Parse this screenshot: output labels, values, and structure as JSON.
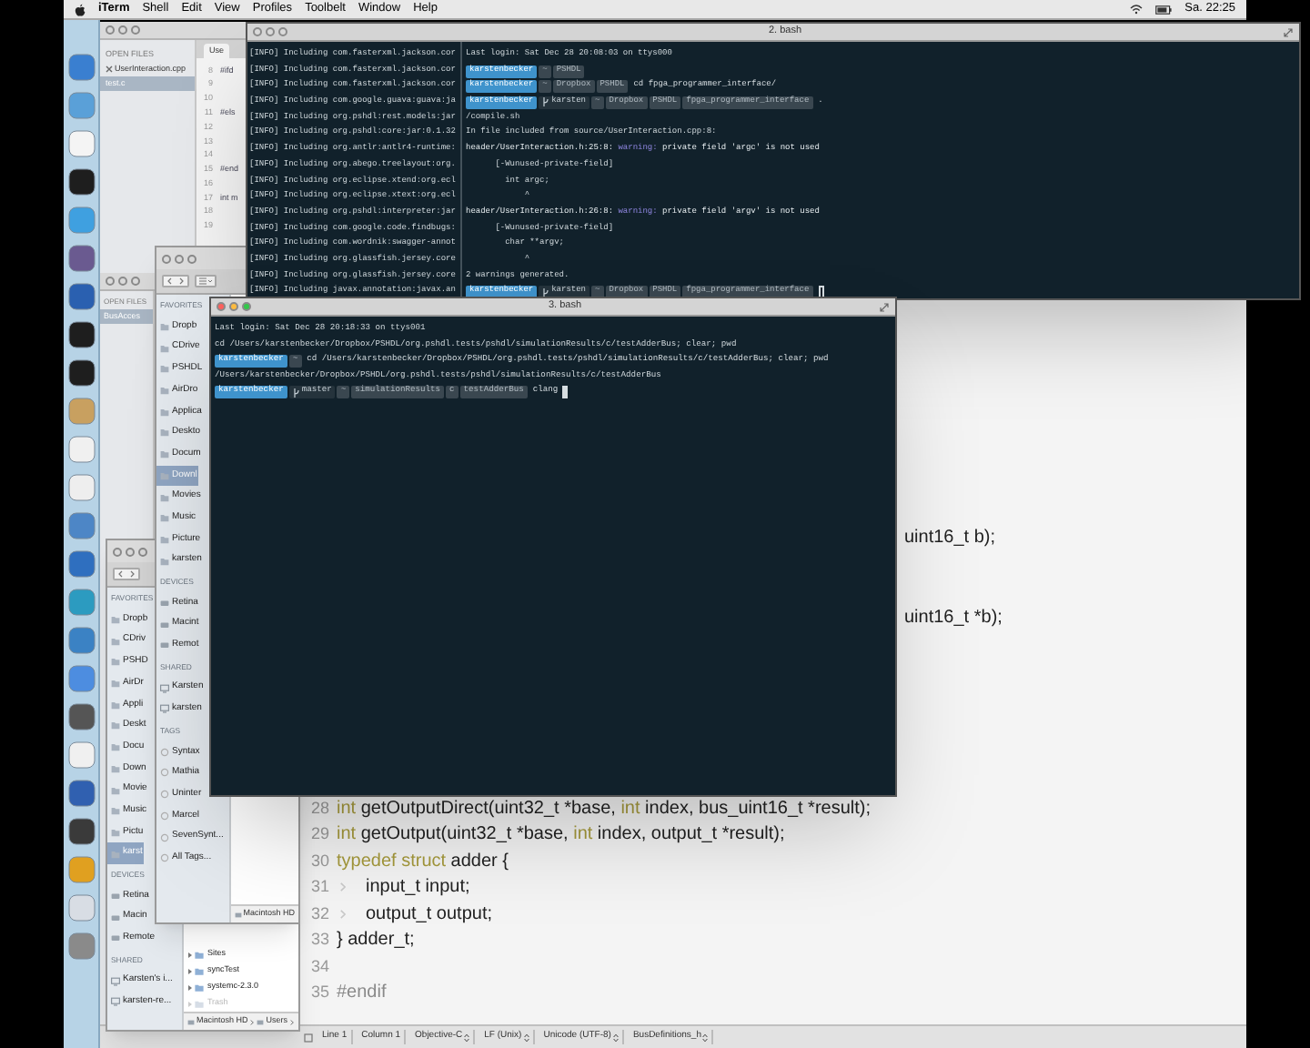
{
  "menu_bar": {
    "app": "iTerm",
    "items": [
      "Shell",
      "Edit",
      "View",
      "Profiles",
      "Toolbelt",
      "Window",
      "Help"
    ],
    "clock": "Sa. 22:25"
  },
  "editor_back": {
    "sidebar_heading": "OPEN FILES",
    "files": [
      {
        "name": "UserInteraction.cpp",
        "selected": false,
        "close_button": true
      },
      {
        "name": "test.c",
        "selected": true,
        "close_button": false
      }
    ],
    "tab": "Use",
    "lines": [
      {
        "number": "8",
        "text": "#ifd"
      },
      {
        "number": "9"
      },
      {
        "number": "10"
      },
      {
        "number": "11",
        "text": "#els"
      },
      {
        "number": "12"
      },
      {
        "number": "13"
      },
      {
        "number": "14"
      },
      {
        "number": "15",
        "text": "#end"
      },
      {
        "number": "16"
      },
      {
        "number": "17",
        "text": "int m"
      },
      {
        "number": "18"
      },
      {
        "number": "19"
      }
    ]
  },
  "editor": {
    "sidebar_heading": "OPEN FILES",
    "files": [
      {
        "name": "BusAcces",
        "selected": true
      }
    ],
    "fragments": [
      "uint16_t b);",
      "uint16_t *b);"
    ],
    "lines": [
      {
        "number": "28",
        "tokens": [
          {
            "kind": "keyword",
            "text": "int"
          },
          {
            "kind": "plain",
            "text": " getOutputDirect(uint32_t *base, "
          },
          {
            "kind": "keyword",
            "text": "int"
          },
          {
            "kind": "plain",
            "text": " index, bus_uint16_t *result);"
          }
        ]
      },
      {
        "number": "29",
        "tokens": [
          {
            "kind": "keyword",
            "text": "int"
          },
          {
            "kind": "plain",
            "text": " getOutput(uint32_t *base, "
          },
          {
            "kind": "keyword",
            "text": "int"
          },
          {
            "kind": "plain",
            "text": " index, output_t *result);"
          }
        ]
      },
      {
        "number": "30",
        "tokens": [
          {
            "kind": "keyword",
            "text": "typedef struct"
          },
          {
            "kind": "plain",
            "text": " adder {"
          }
        ]
      },
      {
        "number": "31",
        "tokens": [
          {
            "kind": "tab"
          },
          {
            "kind": "plain",
            "text": "input_t input;"
          }
        ]
      },
      {
        "number": "32",
        "tokens": [
          {
            "kind": "tab"
          },
          {
            "kind": "plain",
            "text": "output_t output;"
          }
        ]
      },
      {
        "number": "33",
        "tokens": [
          {
            "kind": "plain",
            "text": "} adder_t;"
          }
        ]
      },
      {
        "number": "34"
      },
      {
        "number": "35",
        "tokens": [
          {
            "kind": "directive",
            "text": "#endif"
          }
        ]
      }
    ],
    "status_bar": [
      {
        "label": "Line 1",
        "dropdown": false
      },
      {
        "label": "Column 1",
        "dropdown": false
      },
      {
        "label": "Objective-C",
        "dropdown": true
      },
      {
        "label": "LF (Unix)",
        "dropdown": true
      },
      {
        "label": "Unicode (UTF-8)",
        "dropdown": true
      },
      {
        "label": "BusDefinitions_h",
        "dropdown": true
      }
    ]
  },
  "finders": [
    {
      "sections": [
        {
          "kind": "favorites",
          "heading": "FAVORITES",
          "items": [
            {
              "label": "Dropb",
              "selected": false
            },
            {
              "label": "CDrive",
              "selected": false
            },
            {
              "label": "PSHDL",
              "selected": false
            },
            {
              "label": "AirDro",
              "selected": false
            },
            {
              "label": "Applica",
              "selected": false
            },
            {
              "label": "Deskto",
              "selected": false
            },
            {
              "label": "Docum",
              "selected": false
            },
            {
              "label": "Downl",
              "selected": true
            },
            {
              "label": "Movies",
              "selected": false
            },
            {
              "label": "Music",
              "selected": false
            },
            {
              "label": "Picture",
              "selected": false
            },
            {
              "label": "karsten",
              "selected": false
            }
          ]
        },
        {
          "kind": "devices",
          "heading": "DEVICES",
          "items": [
            {
              "label": "Retina",
              "selected": false
            },
            {
              "label": "Macint",
              "selected": false
            },
            {
              "label": "Remot",
              "selected": false
            }
          ]
        },
        {
          "kind": "shared",
          "heading": "SHARED",
          "items": [
            {
              "label": "Karsten",
              "selected": false
            },
            {
              "label": "karsten",
              "selected": false
            }
          ]
        },
        {
          "kind": "tags",
          "heading": "TAGS",
          "items": [
            {
              "label": "Syntax",
              "selected": false
            },
            {
              "label": "Mathia",
              "selected": false
            },
            {
              "label": "Uninter",
              "selected": false
            },
            {
              "label": "Marcel",
              "selected": false
            },
            {
              "label": "SevenSynt...",
              "selected": false
            },
            {
              "label": "All Tags...",
              "selected": false
            }
          ]
        }
      ],
      "path": [
        "Macintosh HD"
      ]
    },
    {
      "sections": [
        {
          "kind": "favorites",
          "heading": "FAVORITES",
          "items": [
            {
              "label": "Dropb",
              "selected": false
            },
            {
              "label": "CDriv",
              "selected": false
            },
            {
              "label": "PSHD",
              "selected": false
            },
            {
              "label": "AirDr",
              "selected": false
            },
            {
              "label": "Appli",
              "selected": false
            },
            {
              "label": "Deskt",
              "selected": false
            },
            {
              "label": "Docu",
              "selected": false
            },
            {
              "label": "Down",
              "selected": false
            },
            {
              "label": "Movie",
              "selected": false
            },
            {
              "label": "Music",
              "selected": false
            },
            {
              "label": "Pictu",
              "selected": false
            },
            {
              "label": "karst",
              "selected": true
            }
          ]
        },
        {
          "kind": "devices",
          "heading": "DEVICES",
          "items": [
            {
              "label": "Retina",
              "selected": false
            },
            {
              "label": "Macin",
              "selected": false
            },
            {
              "label": "Remote",
              "selected": false
            }
          ]
        },
        {
          "kind": "shared",
          "heading": "SHARED",
          "items": [
            {
              "label": "Karsten's i...",
              "selected": false
            },
            {
              "label": "karsten-re...",
              "selected": false
            }
          ]
        }
      ],
      "files": [
        {
          "name": "Sites",
          "disabled": false
        },
        {
          "name": "syncTest",
          "disabled": false
        },
        {
          "name": "systemc-2.3.0",
          "disabled": false
        },
        {
          "name": "Trash",
          "disabled": true
        }
      ],
      "path": [
        "Macintosh HD",
        "Users"
      ]
    }
  ],
  "terminals": [
    {
      "title": "2. bash",
      "focused": false,
      "left_pane": [
        "[INFO] Including com.fasterxml.jackson.cor",
        "[INFO] Including com.fasterxml.jackson.cor",
        "[INFO] Including com.fasterxml.jackson.cor",
        "[INFO] Including com.google.guava:guava:ja",
        "[INFO] Including org.pshdl:rest.models:jar",
        "[INFO] Including org.pshdl:core:jar:0.1.32",
        "[INFO] Including org.antlr:antlr4-runtime:",
        "[INFO] Including org.abego.treelayout:org.",
        "[INFO] Including org.eclipse.xtend:org.ecl",
        "[INFO] Including org.eclipse.xtext:org.ecl",
        "[INFO] Including org.pshdl:interpreter:jar",
        "[INFO] Including com.google.code.findbugs:",
        "[INFO] Including com.wordnik:swagger-annot",
        "[INFO] Including org.glassfish.jersey.core",
        "[INFO] Including org.glassfish.jersey.core",
        "[INFO] Including javax.annotation:javax.an"
      ],
      "lines": [
        {
          "kind": "text",
          "text": "Last login: Sat Dec 28 20:08:03 on ttys000"
        },
        {
          "kind": "prompt",
          "segments": [
            {
              "kind": "user",
              "text": "karstenbecker"
            },
            {
              "kind": "path",
              "text": "~"
            },
            {
              "kind": "path",
              "text": "PSHDL"
            }
          ],
          "cursor": false
        },
        {
          "kind": "prompt",
          "segments": [
            {
              "kind": "user",
              "text": "karstenbecker"
            },
            {
              "kind": "path",
              "text": "~"
            },
            {
              "kind": "path",
              "text": "Dropbox"
            },
            {
              "kind": "path",
              "text": "PSHDL"
            }
          ],
          "command": "cd fpga_programmer_interface/",
          "cursor": false
        },
        {
          "kind": "prompt",
          "segments": [
            {
              "kind": "user",
              "text": "karstenbecker"
            },
            {
              "kind": "branch",
              "text": "karsten"
            },
            {
              "kind": "path",
              "text": "~"
            },
            {
              "kind": "path",
              "text": "Dropbox"
            },
            {
              "kind": "path",
              "text": "PSHDL"
            },
            {
              "kind": "path",
              "text": "fpga_programmer_interface"
            }
          ],
          "command": ".",
          "cursor": false
        },
        {
          "kind": "text",
          "text": "/compile.sh"
        },
        {
          "kind": "text",
          "text": "In file included from source/UserInteraction.cpp:8:"
        },
        {
          "kind": "warning",
          "location": "header/UserInteraction.h:25:8:",
          "label": "warning:",
          "message": "private field 'argc' is not used"
        },
        {
          "kind": "text",
          "text": "      [-Wunused-private-field]"
        },
        {
          "kind": "text",
          "text": "        int argc;"
        },
        {
          "kind": "text",
          "text": "            ^"
        },
        {
          "kind": "warning",
          "location": "header/UserInteraction.h:26:8:",
          "label": "warning:",
          "message": "private field 'argv' is not used"
        },
        {
          "kind": "text",
          "text": "      [-Wunused-private-field]"
        },
        {
          "kind": "text",
          "text": "        char **argv;"
        },
        {
          "kind": "text",
          "text": "            ^"
        },
        {
          "kind": "text",
          "text": "2 warnings generated."
        },
        {
          "kind": "prompt",
          "segments": [
            {
              "kind": "user",
              "text": "karstenbecker"
            },
            {
              "kind": "branch",
              "text": "karsten"
            },
            {
              "kind": "path",
              "text": "~"
            },
            {
              "kind": "path",
              "text": "Dropbox"
            },
            {
              "kind": "path",
              "text": "PSHDL"
            },
            {
              "kind": "path",
              "text": "fpga_programmer_interface"
            }
          ],
          "cursor": true
        }
      ]
    },
    {
      "title": "3. bash",
      "focused": true,
      "lines": [
        {
          "kind": "text",
          "text": "Last login: Sat Dec 28 20:18:33 on ttys001"
        },
        {
          "kind": "text",
          "text": "cd /Users/karstenbecker/Dropbox/PSHDL/org.pshdl.tests/pshdl/simulationResults/c/testAdderBus; clear; pwd"
        },
        {
          "kind": "prompt",
          "segments": [
            {
              "kind": "user",
              "text": "karstenbecker"
            },
            {
              "kind": "path",
              "text": "~"
            }
          ],
          "command": "cd /Users/karstenbecker/Dropbox/PSHDL/org.pshdl.tests/pshdl/simulationResults/c/testAdderBus; clear; pwd",
          "cursor": false
        },
        {
          "kind": "text",
          "text": "/Users/karstenbecker/Dropbox/PSHDL/org.pshdl.tests/pshdl/simulationResults/c/testAdderBus"
        },
        {
          "kind": "prompt",
          "segments": [
            {
              "kind": "user",
              "text": "karstenbecker"
            },
            {
              "kind": "branch",
              "text": "master"
            },
            {
              "kind": "path",
              "text": "~"
            },
            {
              "kind": "path",
              "text": "simulationResults"
            },
            {
              "kind": "path",
              "text": "c"
            },
            {
              "kind": "path",
              "text": "testAdderBus"
            }
          ],
          "command": "clang",
          "cursor": true
        }
      ]
    }
  ]
}
